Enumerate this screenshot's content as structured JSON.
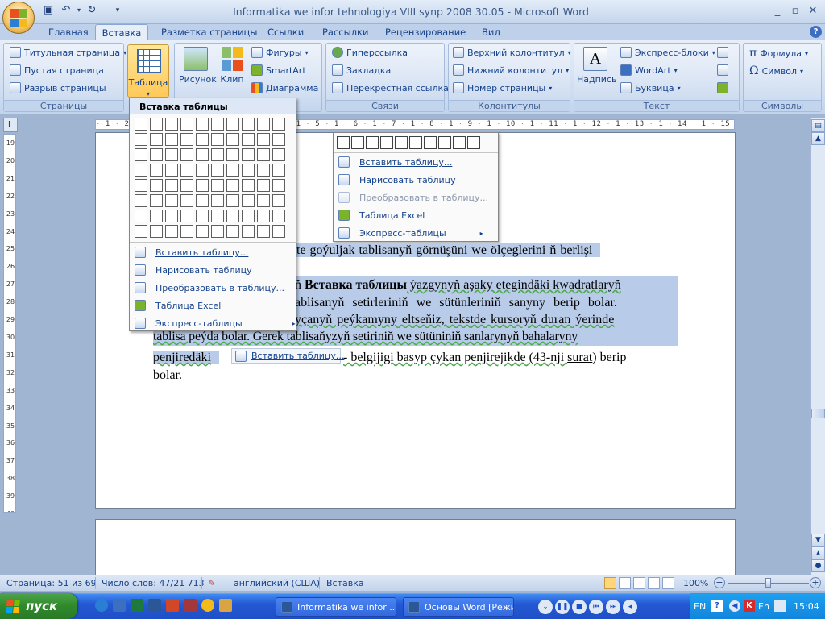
{
  "window": {
    "title": "Informatika we infor tehnologiya VIII synp 2008 30.05 - Microsoft Word",
    "min": "_",
    "max": "▫",
    "close": "✕",
    "help": "?"
  },
  "tabs": [
    "Главная",
    "Вставка",
    "Разметка страницы",
    "Ссылки",
    "Рассылки",
    "Рецензирование",
    "Вид"
  ],
  "ribbon": {
    "pages": {
      "label": "Страницы",
      "items": [
        "Титульная страница",
        "Пустая страница",
        "Разрыв страницы"
      ]
    },
    "table": {
      "label": "Таблица"
    },
    "illustrations": {
      "picture": "Рисунок",
      "clip": "Клип",
      "items": [
        "Фигуры",
        "SmartArt",
        "Диаграмма"
      ]
    },
    "links": {
      "label": "Связи",
      "items": [
        "Гиперссылка",
        "Закладка",
        "Перекрестная ссылка"
      ]
    },
    "headers": {
      "label": "Колонтитулы",
      "items": [
        "Верхний колонтитул",
        "Нижний колонтитул",
        "Номер страницы"
      ]
    },
    "text": {
      "label": "Текст",
      "textbox": "Надпись",
      "items": [
        "Экспресс-блоки",
        "WordArt",
        "Буквица"
      ]
    },
    "symbols": {
      "label": "Символы",
      "items": [
        "Формула",
        "Символ"
      ]
    }
  },
  "popup": {
    "header": "Вставка таблицы",
    "items": [
      "Вставить таблицу...",
      "Нарисовать таблицу",
      "Преобразовать в таблицу...",
      "Таблица Excel",
      "Экспресс-таблицы"
    ]
  },
  "bg_popup": {
    "items": [
      "Вставить таблицу...",
      "Нарисовать таблицу",
      "Преобразовать в таблицу...",
      "Таблица Excel",
      "Экспресс-таблицы"
    ]
  },
  "ruler": {
    "h": "· 1 · 2 · 1 · 1 · 1 · 2 · 1 · 3 · 1 · 4 · 1 · 5 · 1 · 6 · 1 · 7 · 1 · 8 · 1 · 9 · 1 · 10 · 1 · 11 · 1 · 12 · 1 · 13 · 1 · 14 · 1 · 15 · 1 · 16 · 1 · 17 · 1 · 18 · 1 · 19",
    "v": "19\n20\n21\n22\n23\n24\n25\n26\n27\n28\n29\n30\n31\n32\n33\n34\n35\n36\n37\n38\n39\n40\n41"
  },
  "doc": {
    "line1": "te goýuljak tablisanyň görnüşüni we ölçeglerini ň berlişi",
    "line2a": "ň ",
    "line2b": "Вставка таблицы",
    "line2c": " ýazgynyň aşaky etegindäki kwadratlaryň",
    "line3": "ablisanyň setirleriniň we sütünleriniň sanyny berip bolar.",
    "line4": "yçanyň peýkamyny eltseňiz, tekstde kursoryň duran ýerinde",
    "line5": "tablisa peýda bolar. Gerek tablisaňyzyň setiriniň we sütüniniň sanlarynyň bahalaryny",
    "line6a": "penjiredäki",
    "line6b": " - belgijigi basyp çykan penjirejikde (43-nji ",
    "line6c": "surat",
    "line6d": ") berip",
    "line7": "bolar.",
    "inline_btn": "Вставить таблицу..."
  },
  "status": {
    "page": "Страница: 51 из 69",
    "words": "Число слов: 47/21 713",
    "lang": "английский (США)",
    "mode": "Вставка",
    "zoom": "100%",
    "zoom_level": 1.0
  },
  "taskbar": {
    "start": "пуск",
    "tasks": [
      "Informatika we infor ...",
      "Основы Word [Режи..."
    ],
    "lang": "EN",
    "lang2": "En",
    "time": "15:04"
  }
}
